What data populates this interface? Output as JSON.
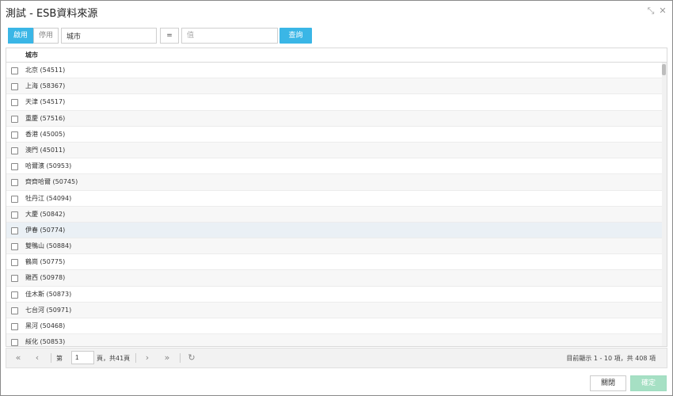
{
  "window": {
    "title": "測試 - ESB資料來源",
    "restore_glyph": "⤡",
    "close_glyph": "✕"
  },
  "toolbar": {
    "enable_label": "啟用",
    "disable_label": "停用",
    "field_value": "城市",
    "operator_value": "=",
    "value_placeholder": "值",
    "query_label": "查詢"
  },
  "grid": {
    "column_header": "城市",
    "rows": [
      "北京 (54511)",
      "上海 (58367)",
      "天津 (54517)",
      "重慶 (57516)",
      "香港 (45005)",
      "澳門 (45011)",
      "哈爾濱 (50953)",
      "齊齊哈爾 (50745)",
      "牡丹江 (54094)",
      "大慶 (50842)",
      "伊春 (50774)",
      "雙鴨山 (50884)",
      "鶴崗 (50775)",
      "雞西 (50978)",
      "佳木斯 (50873)",
      "七台河 (50971)",
      "黑河 (50468)",
      "綏化 (50853)"
    ]
  },
  "pager": {
    "first_glyph": "«",
    "prev_glyph": "‹",
    "next_glyph": "›",
    "last_glyph": "»",
    "refresh_glyph": "↻",
    "page_prefix": "第",
    "page_value": "1",
    "page_suffix": "頁，共41頁",
    "info": "目前顯示 1 - 10 項，共 408 項"
  },
  "footer": {
    "close_label": "關閉",
    "ok_label": "確定"
  },
  "colors": {
    "accent": "#3ab6e6",
    "ok_button": "#a6e0c4",
    "row_highlight": "#eaf0f5"
  }
}
